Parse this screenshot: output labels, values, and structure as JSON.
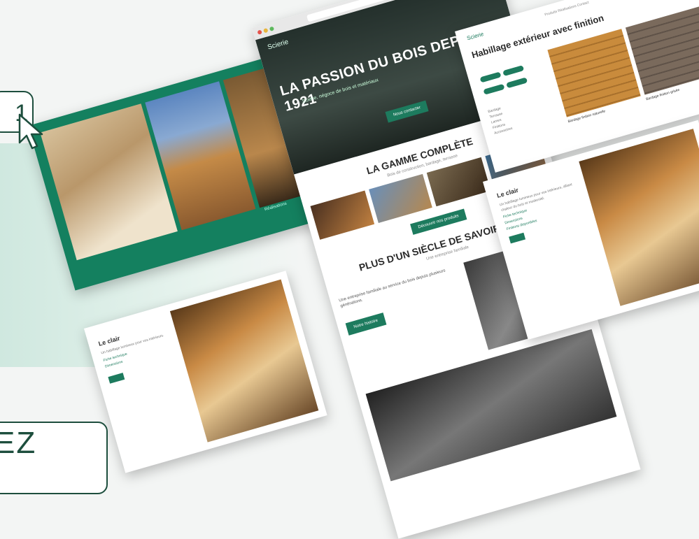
{
  "hero": {
    "logo": "Scierie",
    "title": "LA PASSION DU BOIS DEPUIS 1921",
    "subtitle": "Scierie, négoce de bois et matériaux",
    "cta": "Nous contacter"
  },
  "gamme": {
    "title": "LA GAMME COMPLÈTE",
    "subtitle": "Bois de construction, bardage, terrasse",
    "cta": "Découvrir nos produits"
  },
  "savoir_faire": {
    "title": "PLUS D'UN SIÈCLE DE SAVOIR FAIRE",
    "subtitle": "Une entreprise familiale",
    "body": "Une entreprise familiale au service du bois depuis plusieurs générations.",
    "cta": "Notre histoire"
  },
  "brochure": {
    "caption": "Réalisations"
  },
  "product_page": {
    "logo": "Scierie",
    "nav": "Produits  Réalisations  Contact",
    "title": "Habillage extérieur avec finition",
    "list": [
      "Bardage",
      "Terrasse",
      "Lames",
      "Finitions",
      "Accessoires"
    ],
    "swatch1_label": "Bardage finition naturelle",
    "swatch2_label": "Bardage finition grisée"
  },
  "interior_page": {
    "title": "Le clair",
    "body": "Un habillage lumineux pour vos intérieurs, alliant chaleur du bois et modernité.",
    "links": [
      "Fiche technique",
      "Dimensions",
      "Finitions disponibles"
    ]
  },
  "le_clair_page": {
    "title": "Le clair",
    "body": "Un habillage lumineux pour vos intérieurs.",
    "links": [
      "Fiche technique",
      "Dimensions"
    ]
  },
  "badge": {
    "text": "1"
  },
  "cta_box": {
    "text": "EZ"
  },
  "colors": {
    "brand_green": "#1d7b5e",
    "dark_green": "#1d4e3d"
  }
}
